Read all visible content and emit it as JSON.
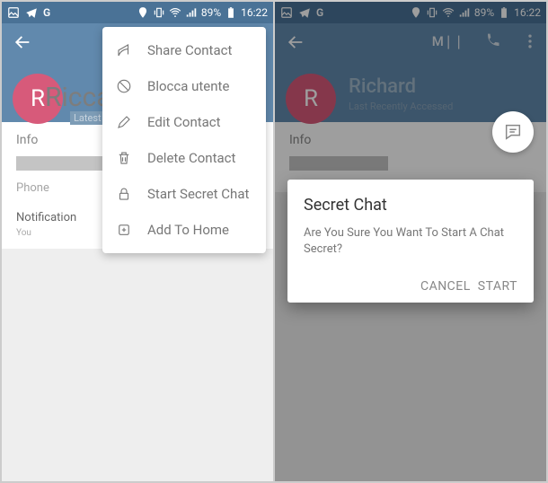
{
  "status": {
    "battery": "89%",
    "time": "16:22"
  },
  "left": {
    "contact_initial": "R",
    "contact_name": "Ricca",
    "latest": "Latest",
    "info": "Info",
    "phone": "Phone",
    "notification": "Notification",
    "notif_sub": "You",
    "menu": {
      "share": "Share Contact",
      "block": "Blocca utente",
      "edit": "Edit Contact",
      "delete": "Delete Contact",
      "secret": "Start Secret Chat",
      "home": "Add To Home"
    }
  },
  "right": {
    "toolbar_m": "M❘❘",
    "contact_initial": "R",
    "contact_name": "Richard",
    "contact_sub": "Last Recently Accessed",
    "info": "Info",
    "dialog": {
      "title": "Secret Chat",
      "text": "Are You Sure You Want To Start A Chat Secret?",
      "cancel": "CANCEL",
      "start": "START"
    }
  }
}
